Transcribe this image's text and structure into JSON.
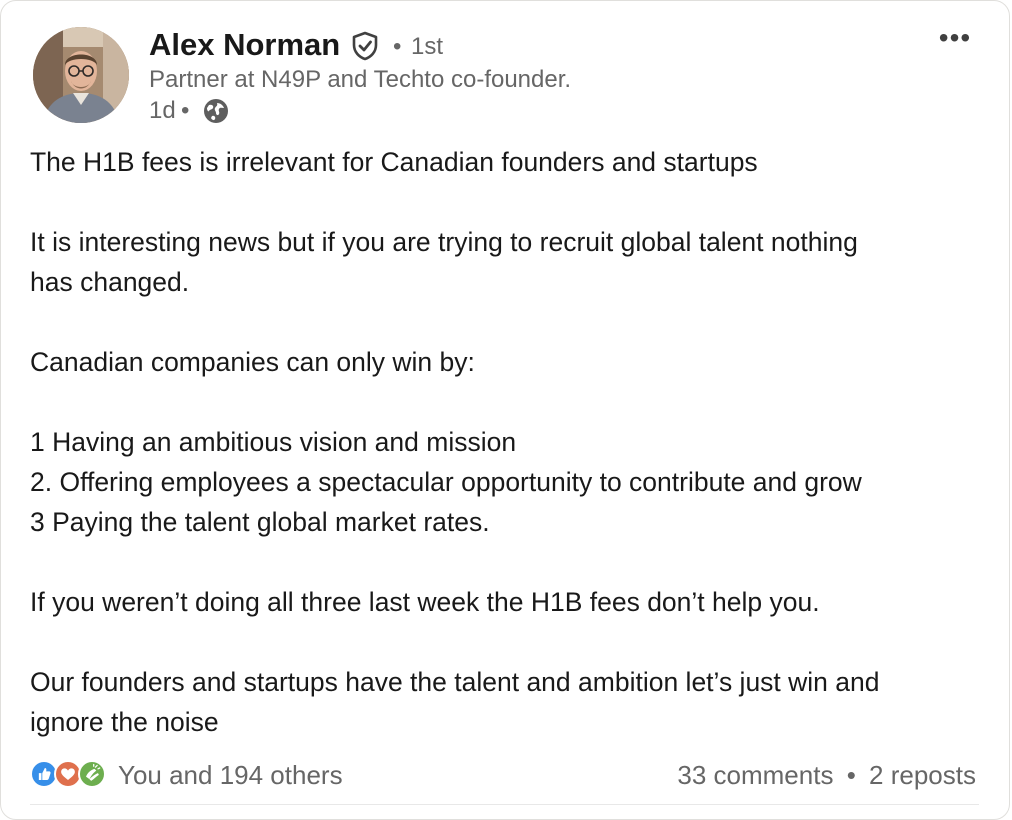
{
  "author": {
    "name": "Alex Norman",
    "verified_icon": "shield-check-icon",
    "connection_sep": "•",
    "connection_degree": "1st",
    "headline": "Partner at N49P and Techto co-founder.",
    "time_ago": "1d",
    "time_sep": "•",
    "visibility_icon": "globe-icon"
  },
  "menu": {
    "more_label": "•••"
  },
  "post": {
    "lines": [
      "The H1B fees is irrelevant for Canadian founders and startups",
      "",
      "It is interesting news but if you are trying to recruit global talent nothing",
      "has changed.",
      "",
      "Canadian companies can only win by:",
      "",
      "1 Having an ambitious vision and mission",
      "2. Offering employees a spectacular opportunity to contribute and grow",
      "3 Paying the talent global market rates.",
      "",
      "If you weren’t doing all three last week the H1B fees don’t help you.",
      "",
      "Our founders and startups have the talent and ambition let’s just win and",
      "ignore the noise"
    ]
  },
  "social": {
    "reaction_icons": [
      "like-icon",
      "love-icon",
      "celebrate-icon"
    ],
    "reactions_text": "You and 194 others",
    "comments_text": "33 comments",
    "separator": "•",
    "reposts_text": "2 reposts"
  },
  "colors": {
    "like": "#378fe9",
    "love": "#df704d",
    "celebrate": "#6dae4f",
    "text_primary": "#191919",
    "text_secondary": "#666666"
  }
}
